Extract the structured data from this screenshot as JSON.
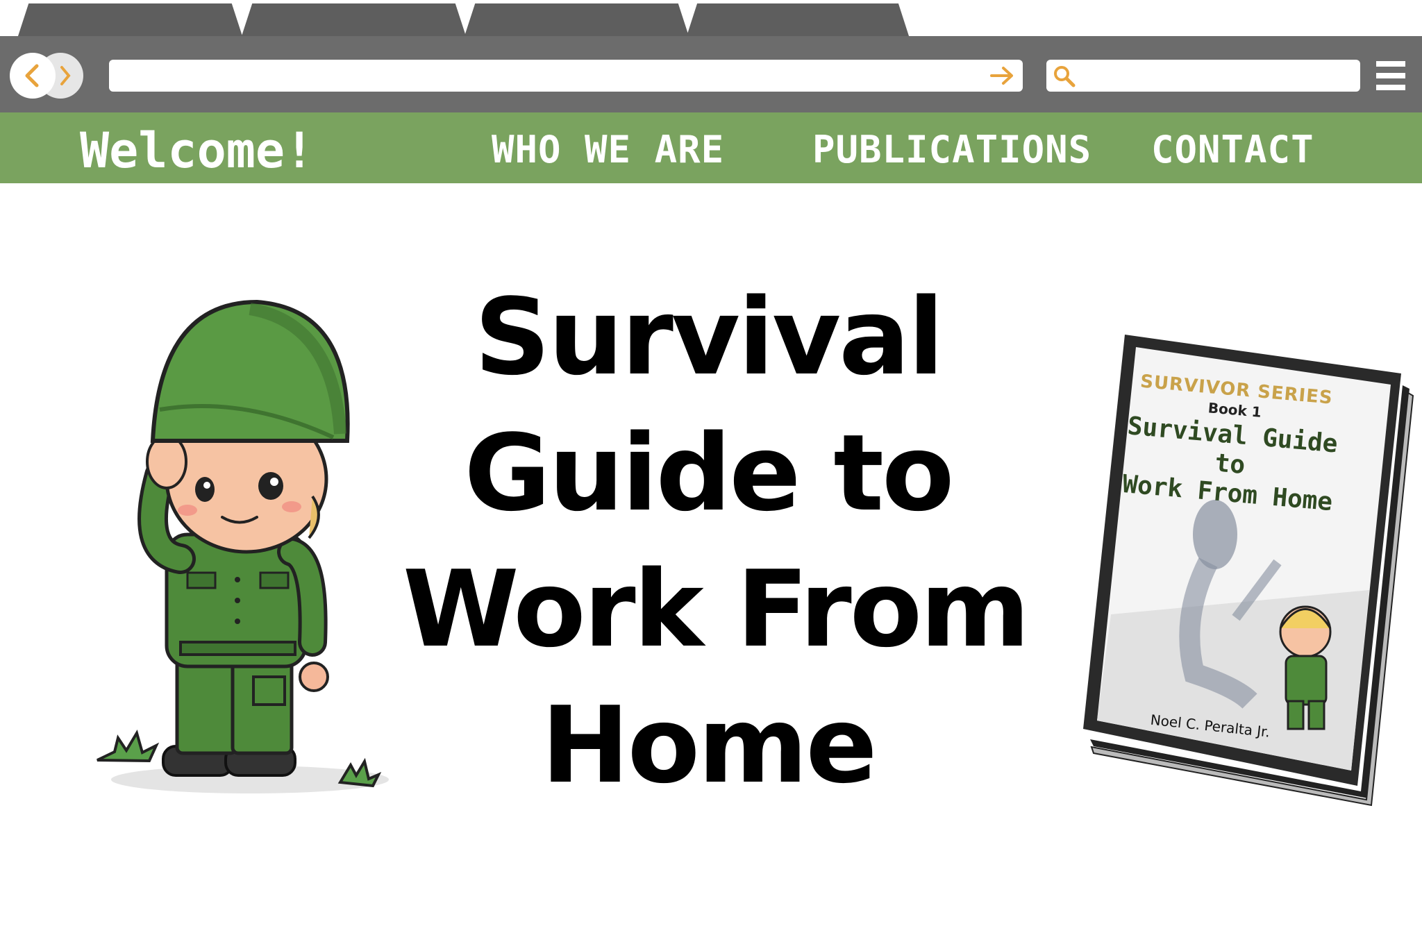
{
  "navbar": {
    "welcome": "Welcome!",
    "links": [
      "WHO WE ARE",
      "PUBLICATIONS",
      "CONTACT"
    ]
  },
  "hero": {
    "title_lines": [
      "Survival",
      "Guide to",
      "Work From",
      "Home"
    ]
  },
  "book": {
    "series": "SURVIVOR SERIES",
    "volume": "Book 1",
    "title_lines": [
      "Survival Guide",
      "to",
      "Work From Home"
    ],
    "author": "Noel C. Peralta Jr."
  },
  "icons": {
    "back": "chevron-left-icon",
    "forward": "chevron-right-icon",
    "go": "arrow-right-icon",
    "search": "search-icon",
    "menu": "hamburger-menu-icon"
  },
  "colors": {
    "chrome": "#6c6c6c",
    "accent_orange": "#e8a33c",
    "nav_green": "#7aa35f",
    "soldier_green": "#4e8a3a"
  }
}
